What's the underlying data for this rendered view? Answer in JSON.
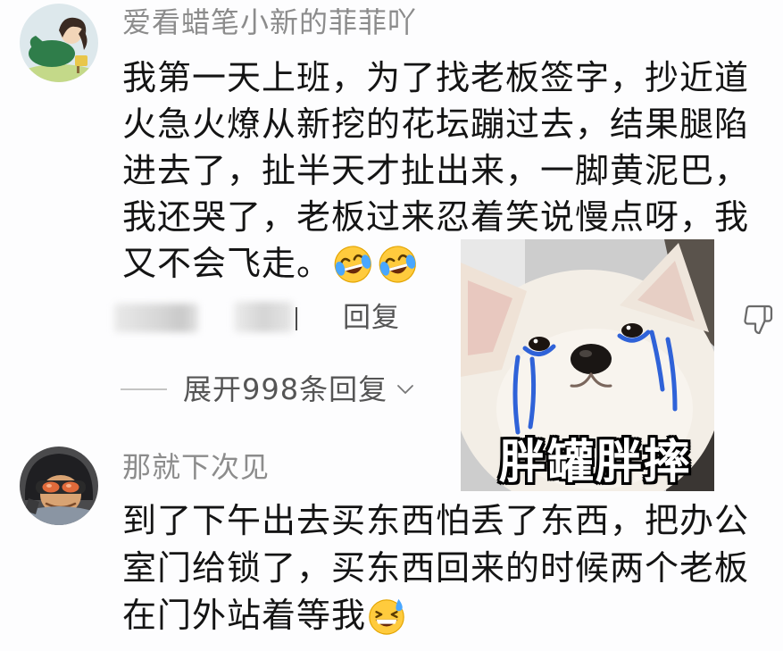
{
  "colors": {
    "background": "#fdfdfe",
    "username": "#8c8c8c",
    "text": "#141414",
    "meta": "#555555",
    "tear": "#2f62d8"
  },
  "comments": [
    {
      "avatar_icon": "cartoon-girl-avatar",
      "username": "爱看蜡笔小新的菲菲吖",
      "lines": [
        "我第一天上班，为了找老板签字，抄近道",
        "火急火燎从新挖的花坛蹦过去，结果腿陷",
        "进去了，扯半天才扯出来，一脚黄泥巴，",
        "我还哭了，老板过来忍着笑说慢点呀，我",
        "又不会飞走。"
      ],
      "trailing_emojis": [
        "face-with-tears-of-joy",
        "face-with-tears-of-joy"
      ],
      "sticker": {
        "icon": "crying-dog-sticker",
        "caption": "胖罐胖摔"
      },
      "reply_label": "回复",
      "dislike_icon": "thumbs-down-icon",
      "expand_replies_label": "展开998条回复",
      "expand_icon": "chevron-down-icon"
    },
    {
      "avatar_icon": "goggles-character-avatar",
      "username": "那就下次见",
      "lines": [
        "到了下午出去买东西怕丢了东西，把办公",
        "室门给锁了，买东西回来的时候两个老板",
        "在门外站着等我"
      ],
      "trailing_emojis": [
        "grinning-face-with-sweat"
      ]
    }
  ]
}
